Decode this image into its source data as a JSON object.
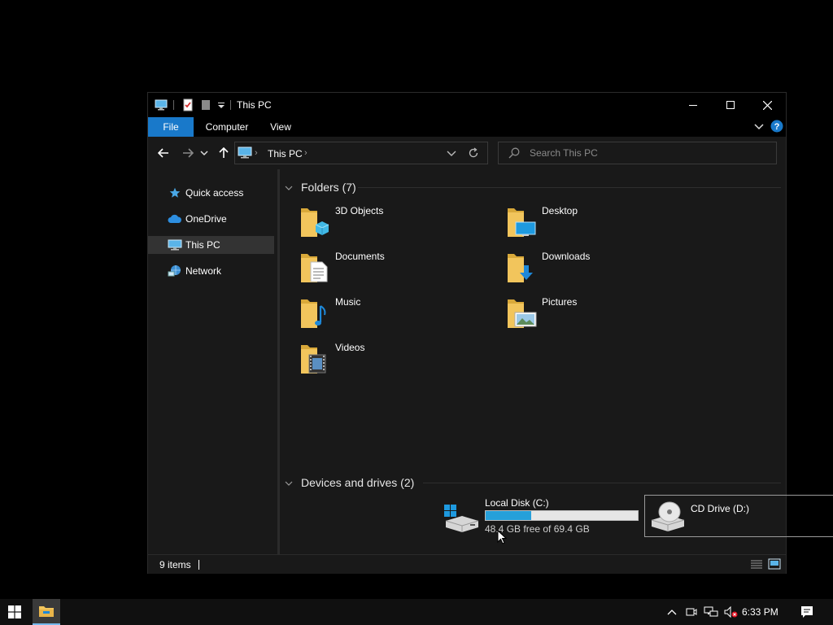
{
  "window": {
    "title": "This PC"
  },
  "ribbon": {
    "tabs": [
      {
        "label": "File"
      },
      {
        "label": "Computer"
      },
      {
        "label": "View"
      }
    ]
  },
  "address": {
    "path": "This PC"
  },
  "search": {
    "placeholder": "Search This PC"
  },
  "sidebar": {
    "items": [
      {
        "label": "Quick access",
        "icon": "star-icon"
      },
      {
        "label": "OneDrive",
        "icon": "cloud-icon"
      },
      {
        "label": "This PC",
        "icon": "computer-icon",
        "selected": true
      },
      {
        "label": "Network",
        "icon": "network-icon"
      }
    ]
  },
  "folders": {
    "header": "Folders (7)",
    "items": [
      {
        "label": "3D Objects",
        "icon": "3d-objects-folder-icon"
      },
      {
        "label": "Desktop",
        "icon": "desktop-folder-icon"
      },
      {
        "label": "Documents",
        "icon": "documents-folder-icon"
      },
      {
        "label": "Downloads",
        "icon": "downloads-folder-icon"
      },
      {
        "label": "Music",
        "icon": "music-folder-icon"
      },
      {
        "label": "Pictures",
        "icon": "pictures-folder-icon"
      },
      {
        "label": "Videos",
        "icon": "videos-folder-icon"
      }
    ]
  },
  "drives": {
    "header": "Devices and drives (2)",
    "items": [
      {
        "label": "Local Disk (C:)",
        "free_text": "48.4 GB free of 69.4 GB",
        "used_fraction": 0.3,
        "icon": "hard-disk-icon"
      },
      {
        "label": "CD Drive (D:)",
        "icon": "cd-drive-icon",
        "selected": true
      }
    ]
  },
  "status": {
    "item_count": "9 items"
  },
  "taskbar": {
    "clock": "6:33 PM"
  },
  "colors": {
    "accent": "#1979ca",
    "progress": "#26a0da",
    "folder": "#f2c55c"
  }
}
